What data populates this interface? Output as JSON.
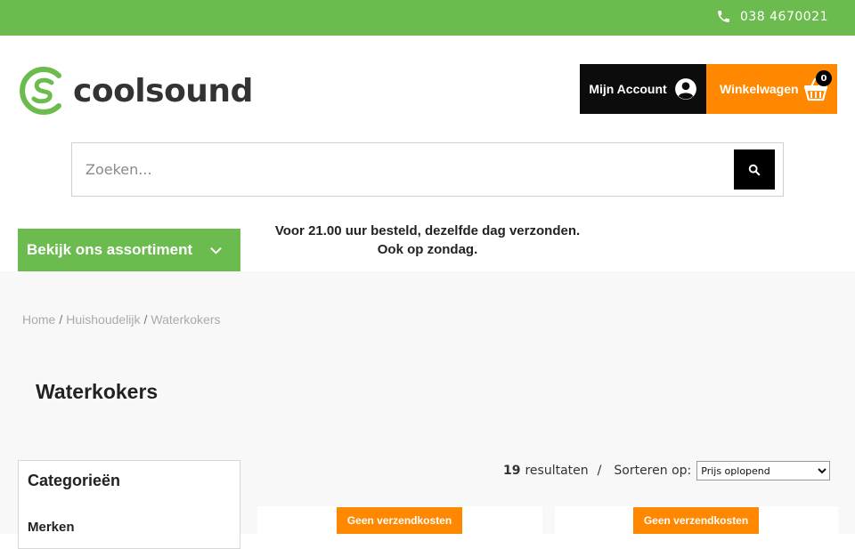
{
  "topbar": {
    "phone": "038 4670021",
    "phone_icon": "phone-icon",
    "bg_color": "#6cbb4f"
  },
  "header": {
    "logo_text": "coolsound",
    "account_label": "Mijn Account",
    "account_icon": "user-circle-icon",
    "cart_label": "Winkelwagen",
    "cart_icon": "basket-icon",
    "cart_count": "0",
    "cart_color": "#ff8800"
  },
  "search": {
    "placeholder": "Zoeken...",
    "button_icon": "search-icon"
  },
  "nav": {
    "assortment_label": "Bekijk ons assortiment",
    "assortment_icon": "chevron-down-icon"
  },
  "promo": {
    "line1": "Voor 21.00 uur besteld, dezelfde dag verzonden.",
    "line2": "Ook op zondag."
  },
  "breadcrumb": {
    "items": [
      "Home",
      "Huishoudelijk",
      "Waterkokers"
    ],
    "separator": "/"
  },
  "page": {
    "title": "Waterkokers"
  },
  "sidebar": {
    "heading": "Categorieën",
    "brands_label": "Merken"
  },
  "toolbar": {
    "result_count": "19",
    "result_label": "resultaten",
    "separator": "/",
    "sort_label": "Sorteren op:",
    "sort_selected": "Prijs oplopend"
  },
  "products": [
    {
      "badge": "Geen verzendkosten"
    },
    {
      "badge": "Geen verzendkosten"
    }
  ]
}
